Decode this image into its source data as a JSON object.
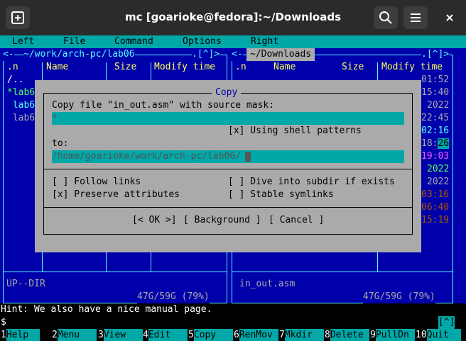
{
  "window": {
    "title": "mc [goarioke@fedora]:~/Downloads",
    "new_tab_icon": "new-tab-icon",
    "search_icon": "search-icon",
    "menu_icon": "hamburger-menu-icon",
    "close_icon": "close-icon"
  },
  "menubar": {
    "left": "Left",
    "file": "File",
    "command": "Command",
    "options": "Options",
    "right": "Right"
  },
  "left_panel": {
    "path": "~/work/arch-pc/lab06",
    "nav_arrows": "<-",
    "corner": ".[^]>",
    "col_n": ".n",
    "col_name": "Name",
    "col_size": "Size",
    "col_mtime": "Modify time",
    "rows": [
      "/..",
      "*lab6",
      " lab6",
      " lab6"
    ],
    "status": "UP--DIR",
    "disk": "47G/59G (79%)"
  },
  "right_panel": {
    "path": "~/Downloads",
    "nav_arrows": "<-",
    "corner": ".[^]>",
    "col_n": ".n",
    "col_name": "Name",
    "col_size": "Size",
    "col_mtime": "Modify time",
    "time_fragments": [
      "01:52",
      "15:40",
      "2022",
      "22:45",
      "02:16",
      "18:26",
      "19:03",
      "2022",
      "2022",
      "03:16",
      "06:40",
      "15:19"
    ],
    "status": "in_out.asm",
    "disk": "47G/59G (79%)"
  },
  "dialog": {
    "title": "Copy",
    "source_label": "Copy file \"in_out.asm\" with source mask:",
    "source_value": "*",
    "shell_patterns": "[x] Using shell patterns",
    "to_label": "to:",
    "to_value": "/home/goarioke/work/arch-pc/lab06/",
    "follow_links": "[ ] Follow links",
    "preserve_attrs": "[x] Preserve attributes",
    "dive_subdir": "[ ] Dive into subdir if exists",
    "stable_symlinks": "[ ] Stable symlinks",
    "ok": "[< OK >]",
    "background": "[ Background ]",
    "cancel": "[ Cancel ]"
  },
  "hint": "Hint: We also have a nice manual page.",
  "prompt": "$",
  "prompt_corner": "[^]",
  "fkeys": [
    {
      "num": "1",
      "label": "Help"
    },
    {
      "num": "2",
      "label": "Menu"
    },
    {
      "num": "3",
      "label": "View"
    },
    {
      "num": "4",
      "label": "Edit"
    },
    {
      "num": "5",
      "label": "Copy"
    },
    {
      "num": "6",
      "label": "RenMov"
    },
    {
      "num": "7",
      "label": "Mkdir"
    },
    {
      "num": "8",
      "label": "Delete"
    },
    {
      "num": "9",
      "label": "PullDn"
    },
    {
      "num": "10",
      "label": "Quit"
    }
  ]
}
